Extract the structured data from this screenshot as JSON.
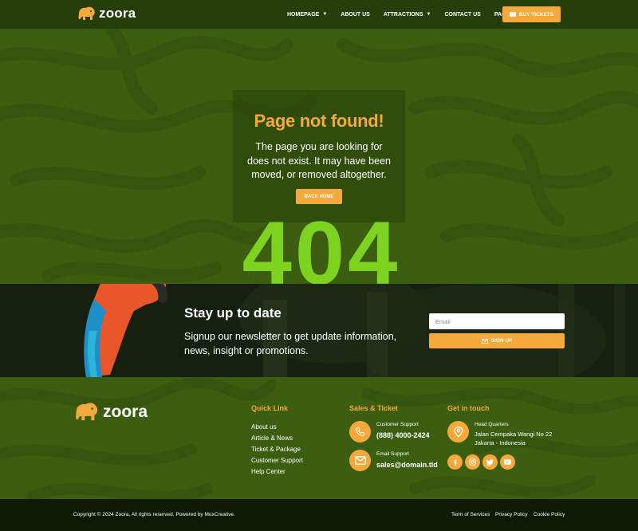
{
  "brand": {
    "name": "zoora"
  },
  "nav": {
    "items": [
      {
        "label": "HOMEPAGE",
        "dropdown": true
      },
      {
        "label": "ABOUT US",
        "dropdown": false
      },
      {
        "label": "ATTRACTIONS",
        "dropdown": true
      },
      {
        "label": "CONTACT US",
        "dropdown": false
      },
      {
        "label": "PAGES",
        "dropdown": true
      }
    ],
    "cta_label": "BUY TICKETS"
  },
  "hero": {
    "title": "Page not found!",
    "message": "The page you are looking for does not exist. It may have been moved, or removed altogether.",
    "button_label": "BACK HOME",
    "code": "404"
  },
  "newsletter": {
    "title": "Stay up to date",
    "text": "Signup our newsletter to get update information, news, insight or promotions.",
    "email_placeholder": "Email",
    "button_label": "SIGN UP"
  },
  "footer": {
    "quick_link": {
      "title": "Quick Link",
      "items": [
        "About us",
        "Article & News",
        "Ticket & Package",
        "Customer Support",
        "Help Center"
      ]
    },
    "sales": {
      "title": "Sales & Ticket",
      "support_label": "Customer Support",
      "phone": "(888) 4000-2424",
      "email_label": "Email Support",
      "email": "sales@domain.tld"
    },
    "contact": {
      "title": "Get in touch",
      "hq_label": "Head Quarters",
      "address_line1": "Jalan Cempaka Wangi No 22",
      "address_line2": "Jakarta - Indonesia"
    }
  },
  "bottom": {
    "copyright": "Copyright © 2024 Zoora, All rights reserved. Powered by MoxCreative.",
    "links": [
      "Term of Services",
      "Privacy Policy",
      "Cookie Policy"
    ]
  },
  "colors": {
    "accent": "#f5a93b",
    "green": "#3c5e10",
    "lime": "#7ed321",
    "dark": "#0f1a05"
  },
  "icons": [
    "elephant-logo",
    "chevron-down-icon",
    "ticket-icon",
    "mail-icon",
    "phone-icon",
    "map-pin-icon",
    "facebook-icon",
    "instagram-icon",
    "twitter-icon",
    "youtube-icon"
  ]
}
